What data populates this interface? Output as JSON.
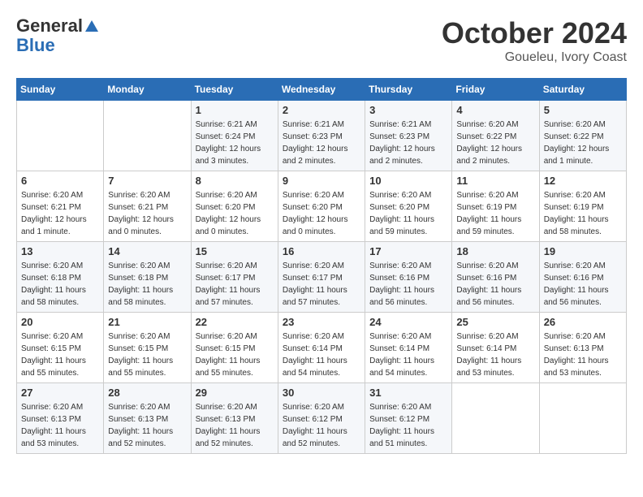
{
  "logo": {
    "general": "General",
    "blue": "Blue"
  },
  "header": {
    "month": "October 2024",
    "location": "Goueleu, Ivory Coast"
  },
  "weekdays": [
    "Sunday",
    "Monday",
    "Tuesday",
    "Wednesday",
    "Thursday",
    "Friday",
    "Saturday"
  ],
  "weeks": [
    [
      {
        "day": "",
        "info": ""
      },
      {
        "day": "",
        "info": ""
      },
      {
        "day": "1",
        "info": "Sunrise: 6:21 AM\nSunset: 6:24 PM\nDaylight: 12 hours and 3 minutes."
      },
      {
        "day": "2",
        "info": "Sunrise: 6:21 AM\nSunset: 6:23 PM\nDaylight: 12 hours and 2 minutes."
      },
      {
        "day": "3",
        "info": "Sunrise: 6:21 AM\nSunset: 6:23 PM\nDaylight: 12 hours and 2 minutes."
      },
      {
        "day": "4",
        "info": "Sunrise: 6:20 AM\nSunset: 6:22 PM\nDaylight: 12 hours and 2 minutes."
      },
      {
        "day": "5",
        "info": "Sunrise: 6:20 AM\nSunset: 6:22 PM\nDaylight: 12 hours and 1 minute."
      }
    ],
    [
      {
        "day": "6",
        "info": "Sunrise: 6:20 AM\nSunset: 6:21 PM\nDaylight: 12 hours and 1 minute."
      },
      {
        "day": "7",
        "info": "Sunrise: 6:20 AM\nSunset: 6:21 PM\nDaylight: 12 hours and 0 minutes."
      },
      {
        "day": "8",
        "info": "Sunrise: 6:20 AM\nSunset: 6:20 PM\nDaylight: 12 hours and 0 minutes."
      },
      {
        "day": "9",
        "info": "Sunrise: 6:20 AM\nSunset: 6:20 PM\nDaylight: 12 hours and 0 minutes."
      },
      {
        "day": "10",
        "info": "Sunrise: 6:20 AM\nSunset: 6:20 PM\nDaylight: 11 hours and 59 minutes."
      },
      {
        "day": "11",
        "info": "Sunrise: 6:20 AM\nSunset: 6:19 PM\nDaylight: 11 hours and 59 minutes."
      },
      {
        "day": "12",
        "info": "Sunrise: 6:20 AM\nSunset: 6:19 PM\nDaylight: 11 hours and 58 minutes."
      }
    ],
    [
      {
        "day": "13",
        "info": "Sunrise: 6:20 AM\nSunset: 6:18 PM\nDaylight: 11 hours and 58 minutes."
      },
      {
        "day": "14",
        "info": "Sunrise: 6:20 AM\nSunset: 6:18 PM\nDaylight: 11 hours and 58 minutes."
      },
      {
        "day": "15",
        "info": "Sunrise: 6:20 AM\nSunset: 6:17 PM\nDaylight: 11 hours and 57 minutes."
      },
      {
        "day": "16",
        "info": "Sunrise: 6:20 AM\nSunset: 6:17 PM\nDaylight: 11 hours and 57 minutes."
      },
      {
        "day": "17",
        "info": "Sunrise: 6:20 AM\nSunset: 6:16 PM\nDaylight: 11 hours and 56 minutes."
      },
      {
        "day": "18",
        "info": "Sunrise: 6:20 AM\nSunset: 6:16 PM\nDaylight: 11 hours and 56 minutes."
      },
      {
        "day": "19",
        "info": "Sunrise: 6:20 AM\nSunset: 6:16 PM\nDaylight: 11 hours and 56 minutes."
      }
    ],
    [
      {
        "day": "20",
        "info": "Sunrise: 6:20 AM\nSunset: 6:15 PM\nDaylight: 11 hours and 55 minutes."
      },
      {
        "day": "21",
        "info": "Sunrise: 6:20 AM\nSunset: 6:15 PM\nDaylight: 11 hours and 55 minutes."
      },
      {
        "day": "22",
        "info": "Sunrise: 6:20 AM\nSunset: 6:15 PM\nDaylight: 11 hours and 55 minutes."
      },
      {
        "day": "23",
        "info": "Sunrise: 6:20 AM\nSunset: 6:14 PM\nDaylight: 11 hours and 54 minutes."
      },
      {
        "day": "24",
        "info": "Sunrise: 6:20 AM\nSunset: 6:14 PM\nDaylight: 11 hours and 54 minutes."
      },
      {
        "day": "25",
        "info": "Sunrise: 6:20 AM\nSunset: 6:14 PM\nDaylight: 11 hours and 53 minutes."
      },
      {
        "day": "26",
        "info": "Sunrise: 6:20 AM\nSunset: 6:13 PM\nDaylight: 11 hours and 53 minutes."
      }
    ],
    [
      {
        "day": "27",
        "info": "Sunrise: 6:20 AM\nSunset: 6:13 PM\nDaylight: 11 hours and 53 minutes."
      },
      {
        "day": "28",
        "info": "Sunrise: 6:20 AM\nSunset: 6:13 PM\nDaylight: 11 hours and 52 minutes."
      },
      {
        "day": "29",
        "info": "Sunrise: 6:20 AM\nSunset: 6:13 PM\nDaylight: 11 hours and 52 minutes."
      },
      {
        "day": "30",
        "info": "Sunrise: 6:20 AM\nSunset: 6:12 PM\nDaylight: 11 hours and 52 minutes."
      },
      {
        "day": "31",
        "info": "Sunrise: 6:20 AM\nSunset: 6:12 PM\nDaylight: 11 hours and 51 minutes."
      },
      {
        "day": "",
        "info": ""
      },
      {
        "day": "",
        "info": ""
      }
    ]
  ]
}
